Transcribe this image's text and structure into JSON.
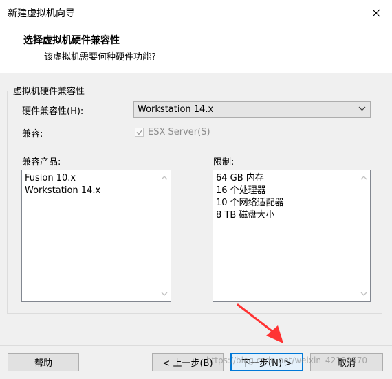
{
  "window": {
    "title": "新建虚拟机向导"
  },
  "header": {
    "title": "选择虚拟机硬件兼容性",
    "subtitle": "该虚拟机需要何种硬件功能?"
  },
  "group": {
    "legend": "虚拟机硬件兼容性",
    "hardware_label": "硬件兼容性(H):",
    "hardware_value": "Workstation 14.x",
    "compat_label": "兼容:",
    "compat_checkbox_label": "ESX Server(S)",
    "compat_checked": true,
    "products_label": "兼容产品:",
    "products": [
      "Fusion 10.x",
      "Workstation 14.x"
    ],
    "limits_label": "限制:",
    "limits": [
      "64 GB 内存",
      "16 个处理器",
      "10 个网络适配器",
      "8 TB 磁盘大小"
    ]
  },
  "buttons": {
    "help": "帮助",
    "back": "< 上一步(B)",
    "next": "下一步(N) >",
    "cancel": "取消"
  },
  "watermark": "https://blog.csdn.net/weixin_42120570",
  "colors": {
    "annotation_arrow": "#ff3333",
    "focus_border": "#0078d7"
  }
}
